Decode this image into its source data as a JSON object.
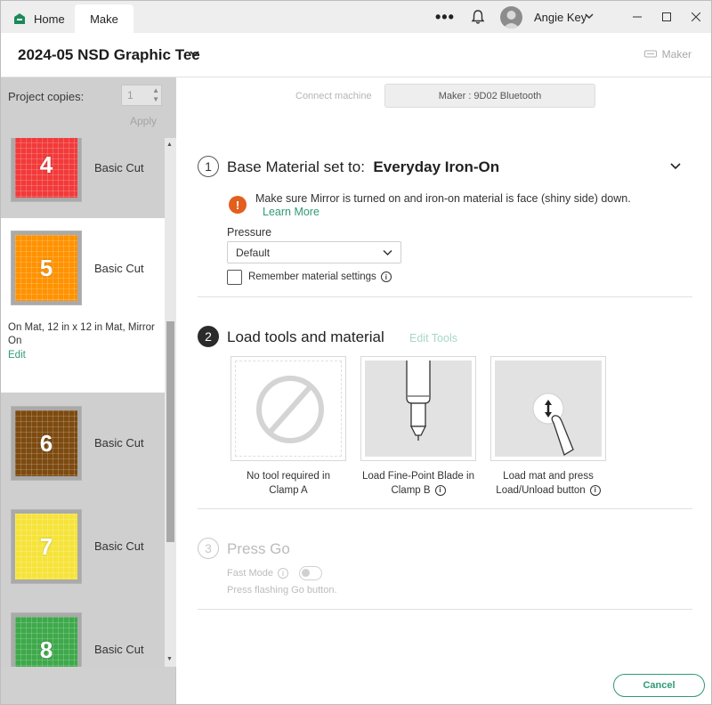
{
  "tabs": [
    {
      "label": "Home",
      "icon": "home-icon"
    },
    {
      "label": "Make"
    }
  ],
  "user": {
    "name": "Angie Key"
  },
  "project": {
    "title": "2024-05 NSD Graphic Tee"
  },
  "header": {
    "machine_label": "Maker"
  },
  "left_panel": {
    "copies_label": "Project copies:",
    "copies_value": "1",
    "apply_label": "Apply",
    "mats": [
      {
        "number": "4",
        "label": "Basic Cut",
        "color": "#f23a3a"
      },
      {
        "number": "5",
        "label": "Basic Cut",
        "color": "#ff9200",
        "selected": true,
        "info": "On Mat, 12 in x 12 in Mat, Mirror On",
        "edit": "Edit"
      },
      {
        "number": "6",
        "label": "Basic Cut",
        "color": "#7d4a10"
      },
      {
        "number": "7",
        "label": "Basic Cut",
        "color": "#f6e33a"
      },
      {
        "number": "8",
        "label": "Basic Cut",
        "color": "#3ea94a"
      }
    ]
  },
  "machine": {
    "connect_label": "Connect machine",
    "device": "Maker : 9D02 Bluetooth"
  },
  "step1": {
    "number": "1",
    "title_prefix": "Base Material set to:",
    "material": "Everyday Iron-On",
    "warning": "Make sure Mirror is turned on and iron-on material is face (shiny side) down.",
    "learn_more": "Learn More",
    "pressure_label": "Pressure",
    "pressure_value": "Default",
    "remember_label": "Remember material settings"
  },
  "step2": {
    "number": "2",
    "title": "Load tools and material",
    "edit_tools": "Edit Tools",
    "tools": [
      {
        "caption_line1": "No tool required in",
        "caption_line2": "Clamp A",
        "icon": "no-tool-icon"
      },
      {
        "caption_line1": "Load Fine-Point Blade in",
        "caption_line2": "Clamp B",
        "icon": "fine-point-blade-icon"
      },
      {
        "caption_line1": "Load mat and press",
        "caption_line2": "Load/Unload button",
        "icon": "load-unload-button-icon"
      }
    ]
  },
  "step3": {
    "number": "3",
    "title": "Press Go",
    "fast_mode": "Fast Mode",
    "hint": "Press flashing Go button."
  },
  "footer": {
    "cancel_label": "Cancel"
  },
  "colors": {
    "accent": "#2f9a78",
    "warning": "#e25f1d"
  }
}
